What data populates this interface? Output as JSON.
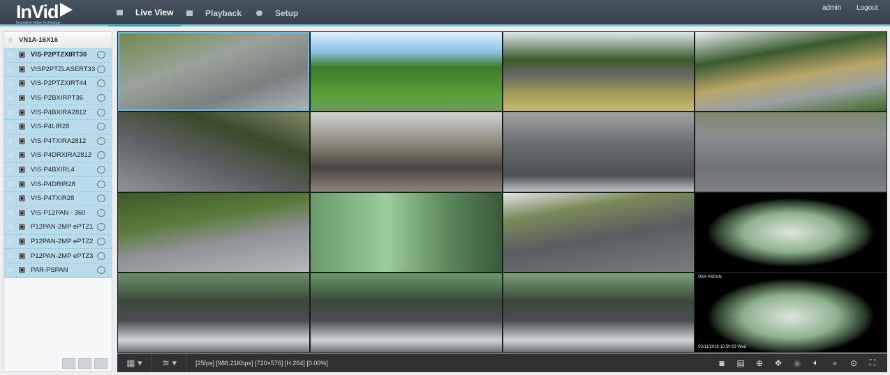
{
  "header": {
    "logo": "InVid",
    "logo_tagline": "Innovative Video Technology",
    "tabs": [
      {
        "label": "Live View",
        "active": true
      },
      {
        "label": "Playback"
      },
      {
        "label": "Setup"
      }
    ],
    "user": "admin",
    "logout": "Logout"
  },
  "sidebar": {
    "device": "VN1A-16X16",
    "cameras": [
      "VIS-P2PTZXIRT30",
      "VISP2PTZLASERT33",
      "VIS-P2PTZXIRT44",
      "VIS-P2BXIRPT36",
      "VIS-P4BXIRA2812",
      "VIS-P4LIR28",
      "VIS-P4TXIRA2812",
      "VIS-P4DRXIRA2812",
      "VIS-P4BXIRL4",
      "VIS-P4DRIR28",
      "VIS-P4TXIR28",
      "VIS-P12PAN - 360",
      "P12PAN-2MP ePTZ1",
      "P12PAN-2MP ePTZ2",
      "P12PAN-2MP ePTZ3",
      "PAR-PSPAN"
    ]
  },
  "grid": {
    "tile16_name": "PAR PSPAN",
    "tile16_time": "02/11/2018 10:50:03 Wed"
  },
  "toolbar": {
    "status": "[25fps] [988.21Kbps] [720×576] [H.264] [0.00%]"
  }
}
